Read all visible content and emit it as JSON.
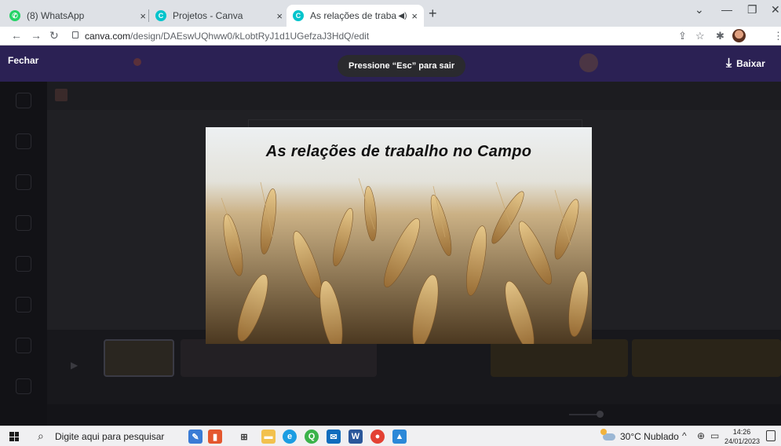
{
  "browser": {
    "tabs": [
      {
        "title": "(8) WhatsApp",
        "favicon": "whatsapp-icon",
        "color": "#25d366"
      },
      {
        "title": "Projetos - Canva",
        "favicon": "canva-icon",
        "color": "#00c4cc"
      },
      {
        "title": "As relações de trabalho no C",
        "favicon": "canva-icon",
        "color": "#00c4cc",
        "active": true
      }
    ],
    "close_glyph": "×",
    "new_tab": "+",
    "url_host": "canva.com",
    "url_path": "/design/DAEswUQhww0/kLobtRyJ1d1UGefzaJ3HdQ/edit"
  },
  "editor": {
    "close_label": "Fechar",
    "download_label": "Baixar",
    "esc_hint": "Pressione “Esc” para sair"
  },
  "slide": {
    "title": "As relações de trabalho no Campo"
  },
  "taskbar": {
    "search_placeholder": "Digite aqui para pesquisar",
    "weather": "30°C  Nublado",
    "time": "14:26",
    "date": "24/01/2023",
    "apps": [
      {
        "name": "paint-icon",
        "color": "#3a7bd5",
        "glyph": "✎"
      },
      {
        "name": "file-explorer-icon",
        "color": "#f2c14e",
        "glyph": "▬"
      },
      {
        "name": "edge-icon",
        "color": "#1b9de2",
        "glyph": "e"
      },
      {
        "name": "qbittorrent-icon",
        "color": "#3bb34a",
        "glyph": "Q"
      },
      {
        "name": "mail-icon",
        "color": "#0f6cbd",
        "glyph": "✉"
      },
      {
        "name": "word-icon",
        "color": "#2b579a",
        "glyph": "W"
      },
      {
        "name": "chrome-icon",
        "color": "#e34133",
        "glyph": "●"
      },
      {
        "name": "photos-icon",
        "color": "#2b88d8",
        "glyph": "▲"
      }
    ]
  },
  "colors": {
    "chrome_tabbar": "#dee1e6",
    "canva_header": "#2b2154",
    "taskbar": "#f0f0f2"
  }
}
